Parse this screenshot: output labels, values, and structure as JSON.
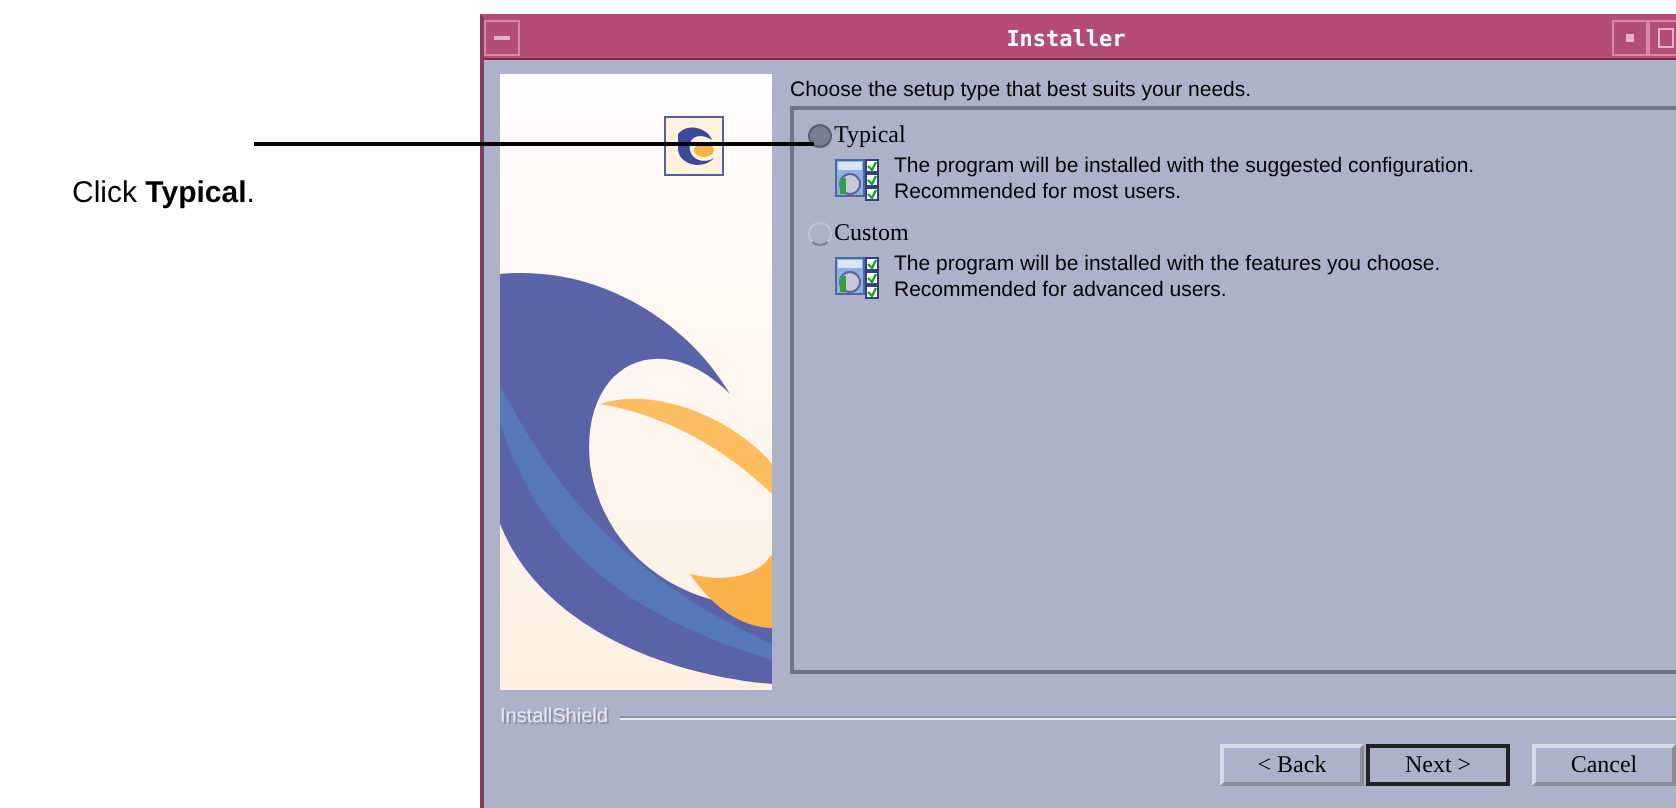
{
  "callout": {
    "text": "Click **Typical**."
  },
  "window": {
    "title": "Installer"
  },
  "instruction": "Choose the setup type that best suits your needs.",
  "options": [
    {
      "label": "Typical",
      "selected": true,
      "lines": [
        "The program will be installed with the suggested configuration.",
        "Recommended for most users."
      ]
    },
    {
      "label": "Custom",
      "selected": false,
      "lines": [
        "The program will be installed with the features you choose.",
        "Recommended for advanced users."
      ]
    }
  ],
  "brand": "InstallShield",
  "buttons": [
    {
      "label": "< Back",
      "default": false
    },
    {
      "label": "Next >",
      "default": true
    },
    {
      "label": "Cancel",
      "default": false
    }
  ]
}
